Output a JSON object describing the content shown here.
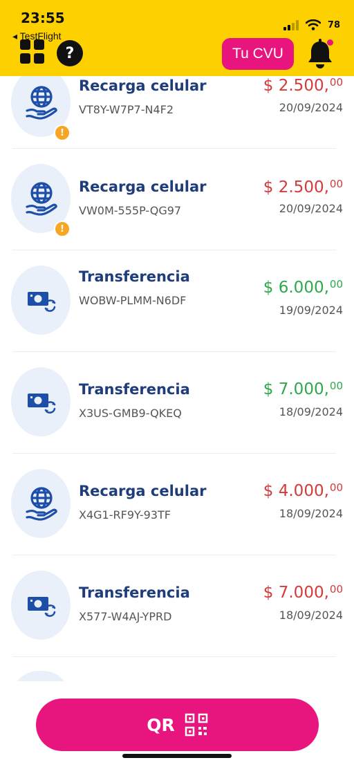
{
  "status_bar": {
    "time": "23:55",
    "back_app": "◂ TestFlight",
    "battery": "78"
  },
  "header": {
    "help_glyph": "?",
    "cvu_label": "Tu CVU",
    "accent": "#E9157F",
    "background": "#FDD100"
  },
  "transactions": [
    {
      "title": "Recarga celular",
      "code": "VT8Y-W7P7-N4F2",
      "amount": "$ 2.500,",
      "cents": "00",
      "date": "20/09/2024",
      "icon": "globe-hand-icon",
      "warning": true,
      "kind": "debit"
    },
    {
      "title": "Recarga celular",
      "code": "VW0M-555P-QG97",
      "amount": "$ 2.500,",
      "cents": "00",
      "date": "20/09/2024",
      "icon": "globe-hand-icon",
      "warning": true,
      "kind": "debit"
    },
    {
      "title": "Transferencia",
      "code": "WOBW-PLMM-N6DF",
      "amount": "$ 6.000,",
      "cents": "00",
      "date": "19/09/2024",
      "icon": "money-transfer-icon",
      "warning": false,
      "kind": "credit"
    },
    {
      "title": "Transferencia",
      "code": "X3US-GMB9-QKEQ",
      "amount": "$ 7.000,",
      "cents": "00",
      "date": "18/09/2024",
      "icon": "money-transfer-icon",
      "warning": false,
      "kind": "credit"
    },
    {
      "title": "Recarga celular",
      "code": "X4G1-RF9Y-93TF",
      "amount": "$ 4.000,",
      "cents": "00",
      "date": "18/09/2024",
      "icon": "globe-hand-icon",
      "warning": false,
      "kind": "debit"
    },
    {
      "title": "Transferencia",
      "code": "X577-W4AJ-YPRD",
      "amount": "$ 7.000,",
      "cents": "00",
      "date": "18/09/2024",
      "icon": "money-transfer-icon",
      "warning": false,
      "kind": "debit"
    }
  ],
  "warning_glyph": "!",
  "qr_button": {
    "label": "QR"
  },
  "colors": {
    "debit": "#D43A3A",
    "credit": "#2EA84A",
    "title": "#1F3D7A",
    "icon": "#1D4FA8"
  }
}
